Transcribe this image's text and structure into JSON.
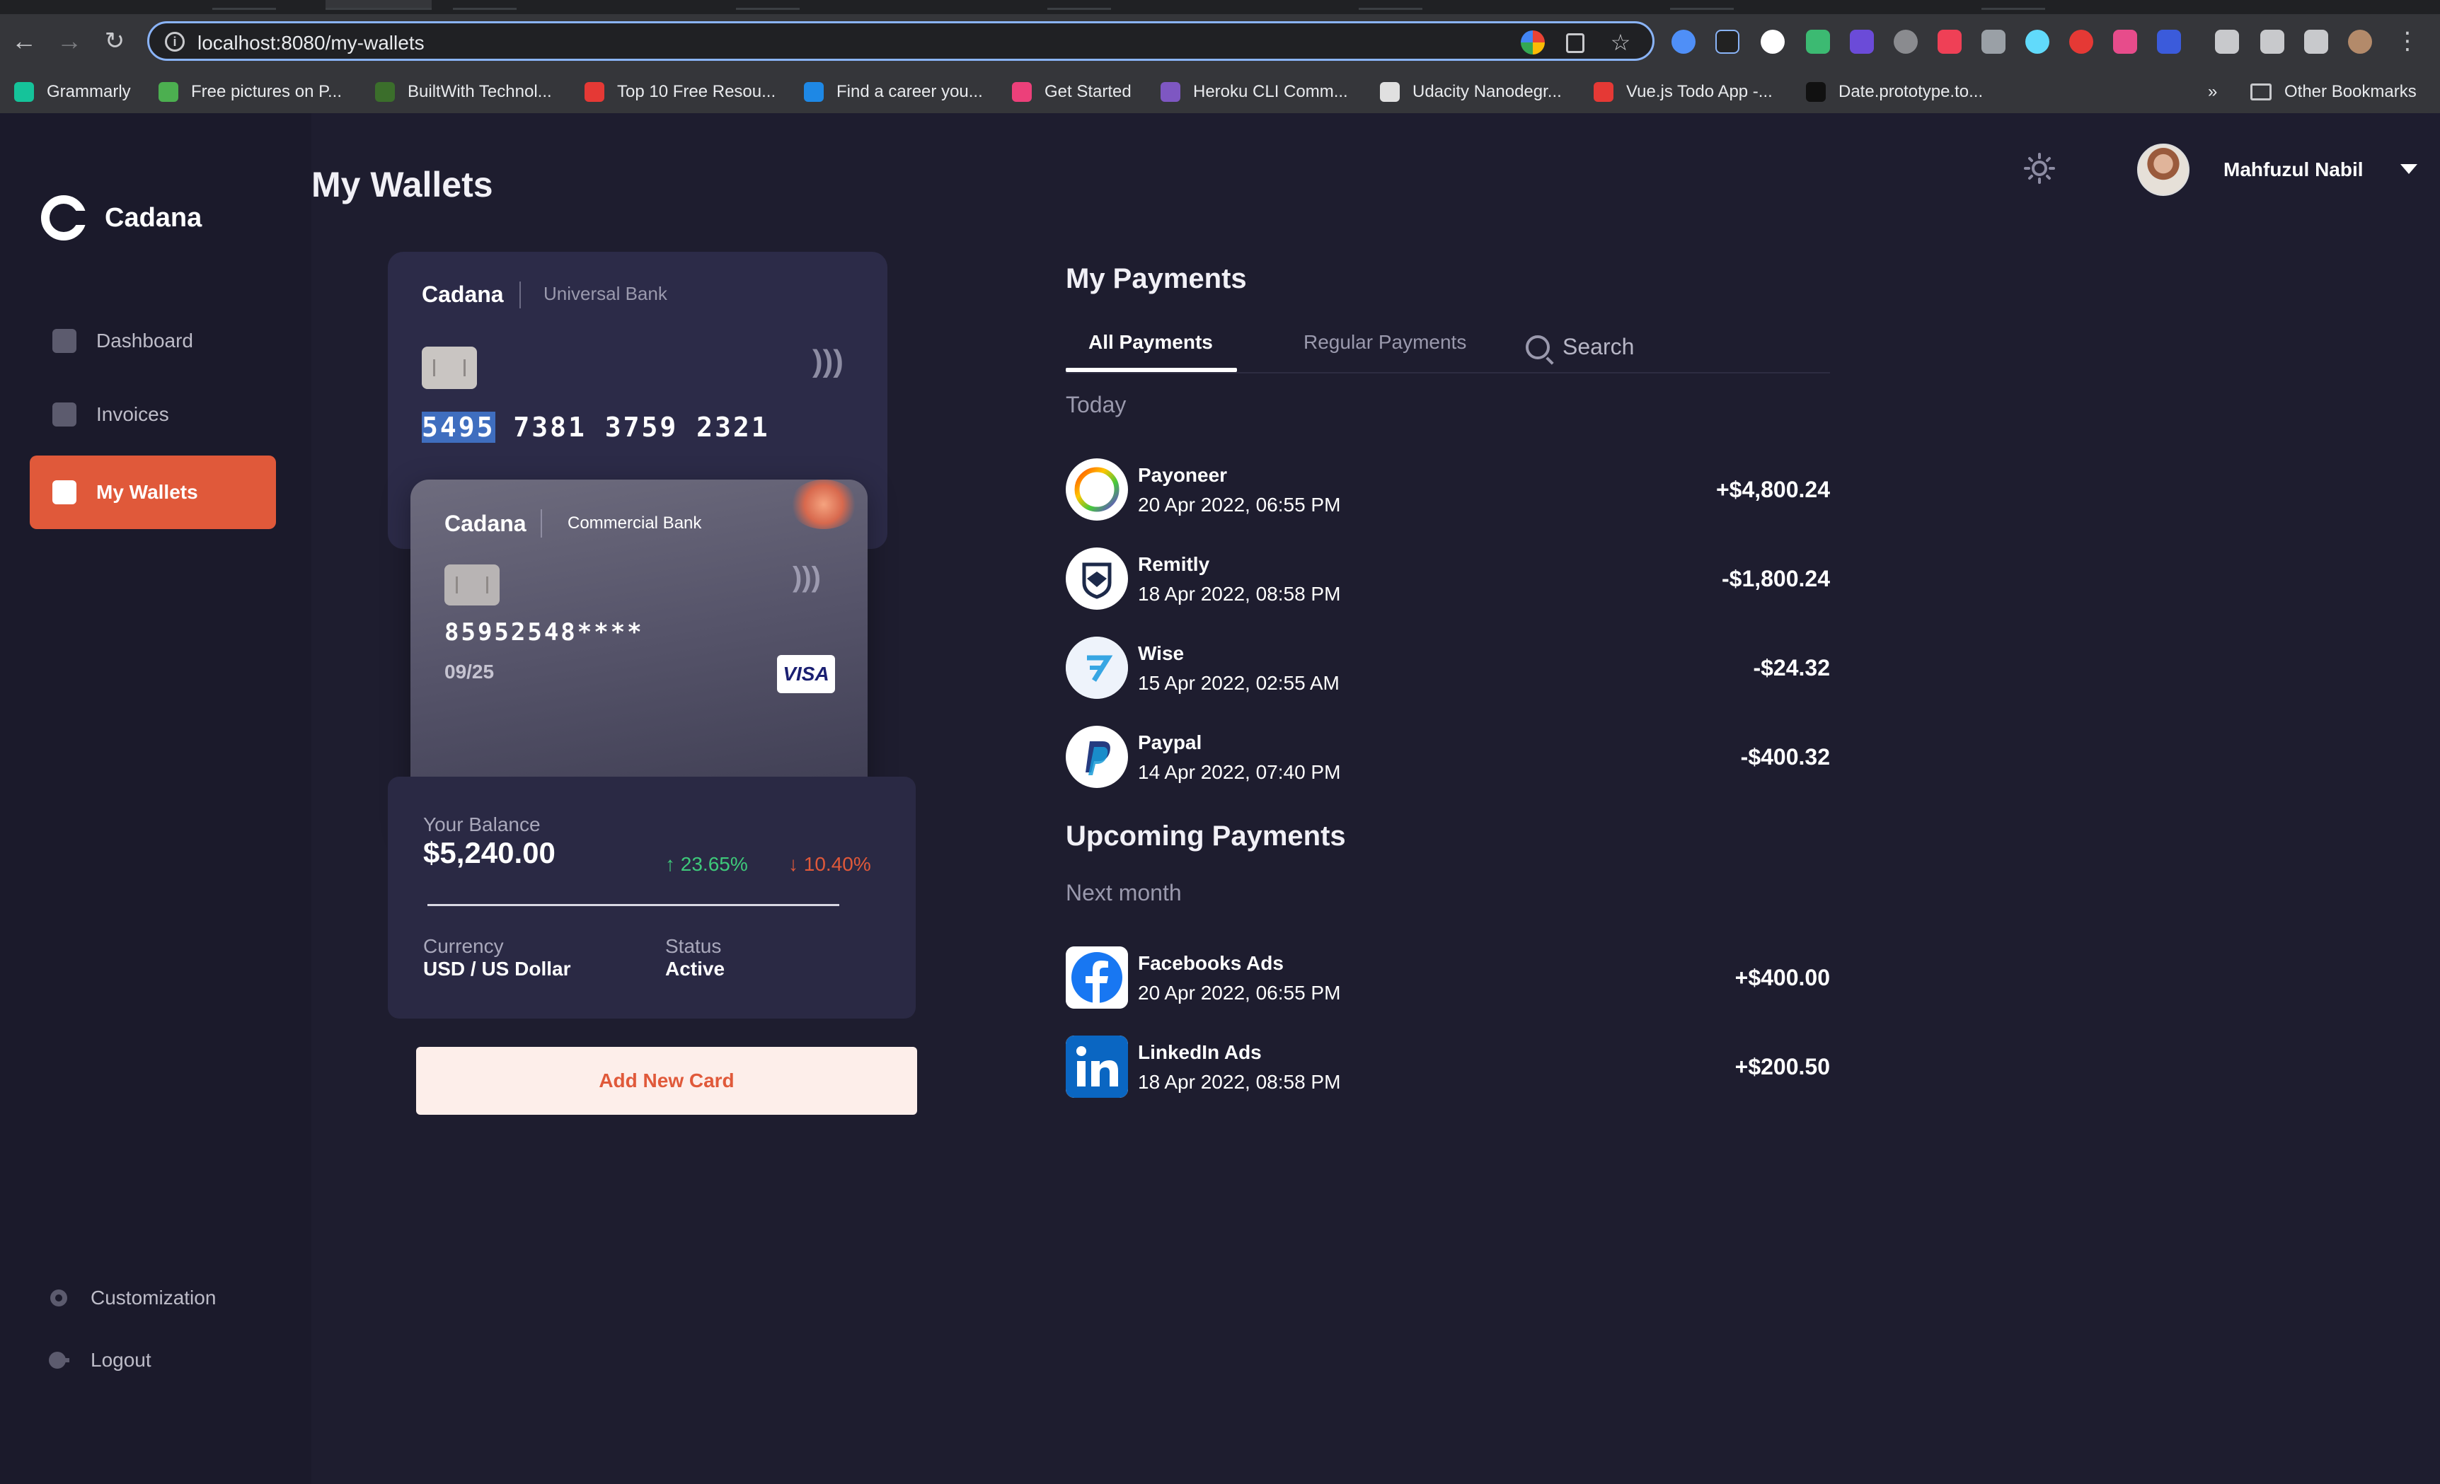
{
  "browser": {
    "url": "localhost:8080/my-wallets",
    "bookmarks": [
      {
        "label": "Grammarly",
        "color": "#15c39a"
      },
      {
        "label": "Free pictures on P...",
        "color": "#4caf50"
      },
      {
        "label": "BuiltWith Technol...",
        "color": "#3b6e2b"
      },
      {
        "label": "Top 10 Free Resou...",
        "color": "#e53935"
      },
      {
        "label": "Find a career you...",
        "color": "#1e88e5"
      },
      {
        "label": "Get Started",
        "color": "#ec407a"
      },
      {
        "label": "Heroku CLI Comm...",
        "color": "#7e57c2"
      },
      {
        "label": "Udacity Nanodegr...",
        "color": "#e0e0e0"
      },
      {
        "label": "Vue.js Todo App -...",
        "color": "#e53935"
      },
      {
        "label": "Date.prototype.to...",
        "color": "#111111"
      }
    ],
    "overflow": "»",
    "other_bookmarks": "Other Bookmarks"
  },
  "sidebar": {
    "brand": "Cadana",
    "items": [
      {
        "label": "Dashboard",
        "icon": "home-icon",
        "active": false
      },
      {
        "label": "Invoices",
        "icon": "receipt-icon",
        "active": false
      },
      {
        "label": "My Wallets",
        "icon": "wallet-icon",
        "active": true
      }
    ],
    "bottom": [
      {
        "label": "Customization",
        "icon": "gear-icon"
      },
      {
        "label": "Logout",
        "icon": "logout-icon"
      }
    ]
  },
  "header": {
    "title": "My Wallets",
    "user_name": "Mahfuzul Nabil"
  },
  "cards": {
    "back": {
      "brand": "Cadana",
      "bank": "Universal Bank",
      "number_selected": "5495",
      "number_rest": " 7381 3759 2321"
    },
    "front": {
      "brand": "Cadana",
      "bank": "Commercial Bank",
      "number": "85952548****",
      "expiry": "09/25",
      "network": "VISA"
    }
  },
  "balance": {
    "label": "Your Balance",
    "value": "$5,240.00",
    "up": "23.65%",
    "down": "10.40%",
    "currency_label": "Currency",
    "currency_value": "USD / US Dollar",
    "status_label": "Status",
    "status_value": "Active"
  },
  "add_card_label": "Add New Card",
  "payments": {
    "title": "My Payments",
    "tabs": [
      "All Payments",
      "Regular Payments"
    ],
    "search_placeholder": "Search",
    "today_label": "Today",
    "today": [
      {
        "name": "Payoneer",
        "date": "20 Apr 2022, 06:55 PM",
        "amount": "+$4,800.24",
        "icon": "payoneer-logo"
      },
      {
        "name": "Remitly",
        "date": "18 Apr 2022, 08:58 PM",
        "amount": "-$1,800.24",
        "icon": "remitly-logo"
      },
      {
        "name": "Wise",
        "date": "15 Apr 2022, 02:55 AM",
        "amount": "-$24.32",
        "icon": "wise-logo"
      },
      {
        "name": "Paypal",
        "date": "14 Apr 2022, 07:40 PM",
        "amount": "-$400.32",
        "icon": "paypal-logo"
      }
    ],
    "upcoming_title": "Upcoming Payments",
    "upcoming_label": "Next month",
    "upcoming": [
      {
        "name": "Facebooks Ads",
        "date": "20 Apr 2022, 06:55 PM",
        "amount": "+$400.00",
        "icon": "facebook-logo"
      },
      {
        "name": "LinkedIn Ads",
        "date": "18 Apr 2022, 08:58 PM",
        "amount": "+$200.50",
        "icon": "linkedin-logo"
      }
    ]
  },
  "colors": {
    "accent": "#e0593a",
    "background": "#1e1d2f",
    "sidebar": "#1b1a2b",
    "positive": "#3ec97a",
    "negative": "#e0593a"
  }
}
